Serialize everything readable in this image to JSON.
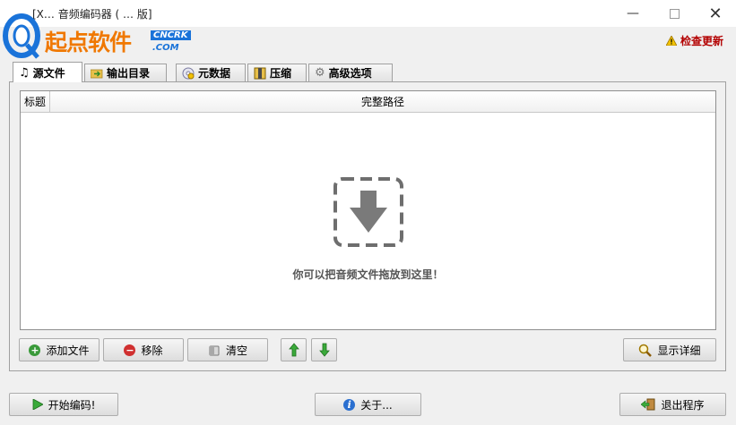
{
  "window": {
    "title": "[X… 音频编码器 ( … 版]"
  },
  "watermark": {
    "brand": "起点软件",
    "site": "CNCRK",
    "domain": ".COM"
  },
  "update": {
    "label": "检查更新"
  },
  "tabs": [
    {
      "label": "源文件",
      "icon": "music-note-icon"
    },
    {
      "label": "输出目录",
      "icon": "folder-arrow-icon"
    },
    {
      "label": "元数据",
      "icon": "cd-icon"
    },
    {
      "label": "压缩",
      "icon": "compress-icon"
    },
    {
      "label": "高级选项",
      "icon": "gear-icon"
    }
  ],
  "file_list": {
    "columns": [
      "标题",
      "完整路径"
    ],
    "drop_hint": "你可以把音频文件拖放到这里！"
  },
  "actions": {
    "add": "添加文件",
    "remove": "移除",
    "clear": "清空",
    "details": "显示详细"
  },
  "footer": {
    "start": "开始编码!",
    "about": "关于...",
    "exit": "退出程序"
  },
  "colors": {
    "accent_orange": "#f07800",
    "accent_blue": "#1a73d9",
    "update_red": "#b30000"
  }
}
